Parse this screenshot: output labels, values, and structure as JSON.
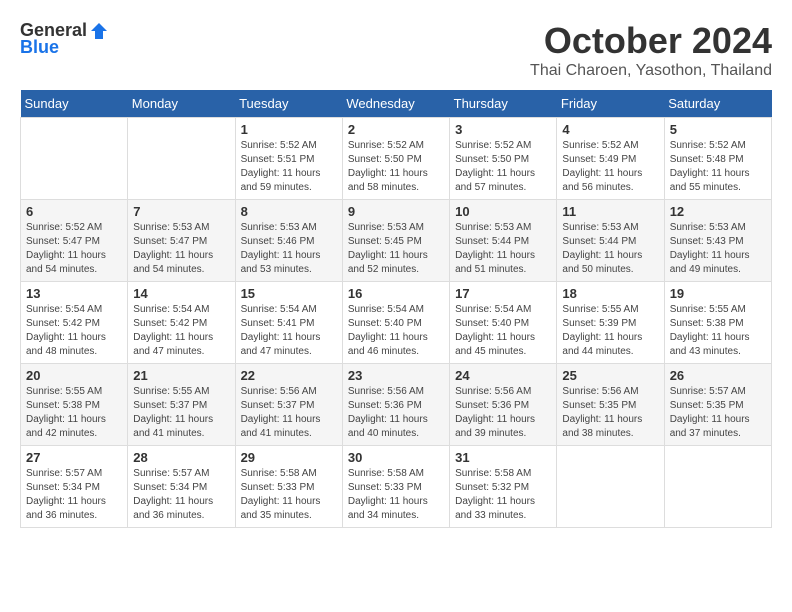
{
  "logo": {
    "general": "General",
    "blue": "Blue"
  },
  "title": "October 2024",
  "subtitle": "Thai Charoen, Yasothon, Thailand",
  "headers": [
    "Sunday",
    "Monday",
    "Tuesday",
    "Wednesday",
    "Thursday",
    "Friday",
    "Saturday"
  ],
  "weeks": [
    [
      {
        "day": "",
        "sunrise": "",
        "sunset": "",
        "daylight": ""
      },
      {
        "day": "",
        "sunrise": "",
        "sunset": "",
        "daylight": ""
      },
      {
        "day": "1",
        "sunrise": "Sunrise: 5:52 AM",
        "sunset": "Sunset: 5:51 PM",
        "daylight": "Daylight: 11 hours and 59 minutes."
      },
      {
        "day": "2",
        "sunrise": "Sunrise: 5:52 AM",
        "sunset": "Sunset: 5:50 PM",
        "daylight": "Daylight: 11 hours and 58 minutes."
      },
      {
        "day": "3",
        "sunrise": "Sunrise: 5:52 AM",
        "sunset": "Sunset: 5:50 PM",
        "daylight": "Daylight: 11 hours and 57 minutes."
      },
      {
        "day": "4",
        "sunrise": "Sunrise: 5:52 AM",
        "sunset": "Sunset: 5:49 PM",
        "daylight": "Daylight: 11 hours and 56 minutes."
      },
      {
        "day": "5",
        "sunrise": "Sunrise: 5:52 AM",
        "sunset": "Sunset: 5:48 PM",
        "daylight": "Daylight: 11 hours and 55 minutes."
      }
    ],
    [
      {
        "day": "6",
        "sunrise": "Sunrise: 5:52 AM",
        "sunset": "Sunset: 5:47 PM",
        "daylight": "Daylight: 11 hours and 54 minutes."
      },
      {
        "day": "7",
        "sunrise": "Sunrise: 5:53 AM",
        "sunset": "Sunset: 5:47 PM",
        "daylight": "Daylight: 11 hours and 54 minutes."
      },
      {
        "day": "8",
        "sunrise": "Sunrise: 5:53 AM",
        "sunset": "Sunset: 5:46 PM",
        "daylight": "Daylight: 11 hours and 53 minutes."
      },
      {
        "day": "9",
        "sunrise": "Sunrise: 5:53 AM",
        "sunset": "Sunset: 5:45 PM",
        "daylight": "Daylight: 11 hours and 52 minutes."
      },
      {
        "day": "10",
        "sunrise": "Sunrise: 5:53 AM",
        "sunset": "Sunset: 5:44 PM",
        "daylight": "Daylight: 11 hours and 51 minutes."
      },
      {
        "day": "11",
        "sunrise": "Sunrise: 5:53 AM",
        "sunset": "Sunset: 5:44 PM",
        "daylight": "Daylight: 11 hours and 50 minutes."
      },
      {
        "day": "12",
        "sunrise": "Sunrise: 5:53 AM",
        "sunset": "Sunset: 5:43 PM",
        "daylight": "Daylight: 11 hours and 49 minutes."
      }
    ],
    [
      {
        "day": "13",
        "sunrise": "Sunrise: 5:54 AM",
        "sunset": "Sunset: 5:42 PM",
        "daylight": "Daylight: 11 hours and 48 minutes."
      },
      {
        "day": "14",
        "sunrise": "Sunrise: 5:54 AM",
        "sunset": "Sunset: 5:42 PM",
        "daylight": "Daylight: 11 hours and 47 minutes."
      },
      {
        "day": "15",
        "sunrise": "Sunrise: 5:54 AM",
        "sunset": "Sunset: 5:41 PM",
        "daylight": "Daylight: 11 hours and 47 minutes."
      },
      {
        "day": "16",
        "sunrise": "Sunrise: 5:54 AM",
        "sunset": "Sunset: 5:40 PM",
        "daylight": "Daylight: 11 hours and 46 minutes."
      },
      {
        "day": "17",
        "sunrise": "Sunrise: 5:54 AM",
        "sunset": "Sunset: 5:40 PM",
        "daylight": "Daylight: 11 hours and 45 minutes."
      },
      {
        "day": "18",
        "sunrise": "Sunrise: 5:55 AM",
        "sunset": "Sunset: 5:39 PM",
        "daylight": "Daylight: 11 hours and 44 minutes."
      },
      {
        "day": "19",
        "sunrise": "Sunrise: 5:55 AM",
        "sunset": "Sunset: 5:38 PM",
        "daylight": "Daylight: 11 hours and 43 minutes."
      }
    ],
    [
      {
        "day": "20",
        "sunrise": "Sunrise: 5:55 AM",
        "sunset": "Sunset: 5:38 PM",
        "daylight": "Daylight: 11 hours and 42 minutes."
      },
      {
        "day": "21",
        "sunrise": "Sunrise: 5:55 AM",
        "sunset": "Sunset: 5:37 PM",
        "daylight": "Daylight: 11 hours and 41 minutes."
      },
      {
        "day": "22",
        "sunrise": "Sunrise: 5:56 AM",
        "sunset": "Sunset: 5:37 PM",
        "daylight": "Daylight: 11 hours and 41 minutes."
      },
      {
        "day": "23",
        "sunrise": "Sunrise: 5:56 AM",
        "sunset": "Sunset: 5:36 PM",
        "daylight": "Daylight: 11 hours and 40 minutes."
      },
      {
        "day": "24",
        "sunrise": "Sunrise: 5:56 AM",
        "sunset": "Sunset: 5:36 PM",
        "daylight": "Daylight: 11 hours and 39 minutes."
      },
      {
        "day": "25",
        "sunrise": "Sunrise: 5:56 AM",
        "sunset": "Sunset: 5:35 PM",
        "daylight": "Daylight: 11 hours and 38 minutes."
      },
      {
        "day": "26",
        "sunrise": "Sunrise: 5:57 AM",
        "sunset": "Sunset: 5:35 PM",
        "daylight": "Daylight: 11 hours and 37 minutes."
      }
    ],
    [
      {
        "day": "27",
        "sunrise": "Sunrise: 5:57 AM",
        "sunset": "Sunset: 5:34 PM",
        "daylight": "Daylight: 11 hours and 36 minutes."
      },
      {
        "day": "28",
        "sunrise": "Sunrise: 5:57 AM",
        "sunset": "Sunset: 5:34 PM",
        "daylight": "Daylight: 11 hours and 36 minutes."
      },
      {
        "day": "29",
        "sunrise": "Sunrise: 5:58 AM",
        "sunset": "Sunset: 5:33 PM",
        "daylight": "Daylight: 11 hours and 35 minutes."
      },
      {
        "day": "30",
        "sunrise": "Sunrise: 5:58 AM",
        "sunset": "Sunset: 5:33 PM",
        "daylight": "Daylight: 11 hours and 34 minutes."
      },
      {
        "day": "31",
        "sunrise": "Sunrise: 5:58 AM",
        "sunset": "Sunset: 5:32 PM",
        "daylight": "Daylight: 11 hours and 33 minutes."
      },
      {
        "day": "",
        "sunrise": "",
        "sunset": "",
        "daylight": ""
      },
      {
        "day": "",
        "sunrise": "",
        "sunset": "",
        "daylight": ""
      }
    ]
  ]
}
